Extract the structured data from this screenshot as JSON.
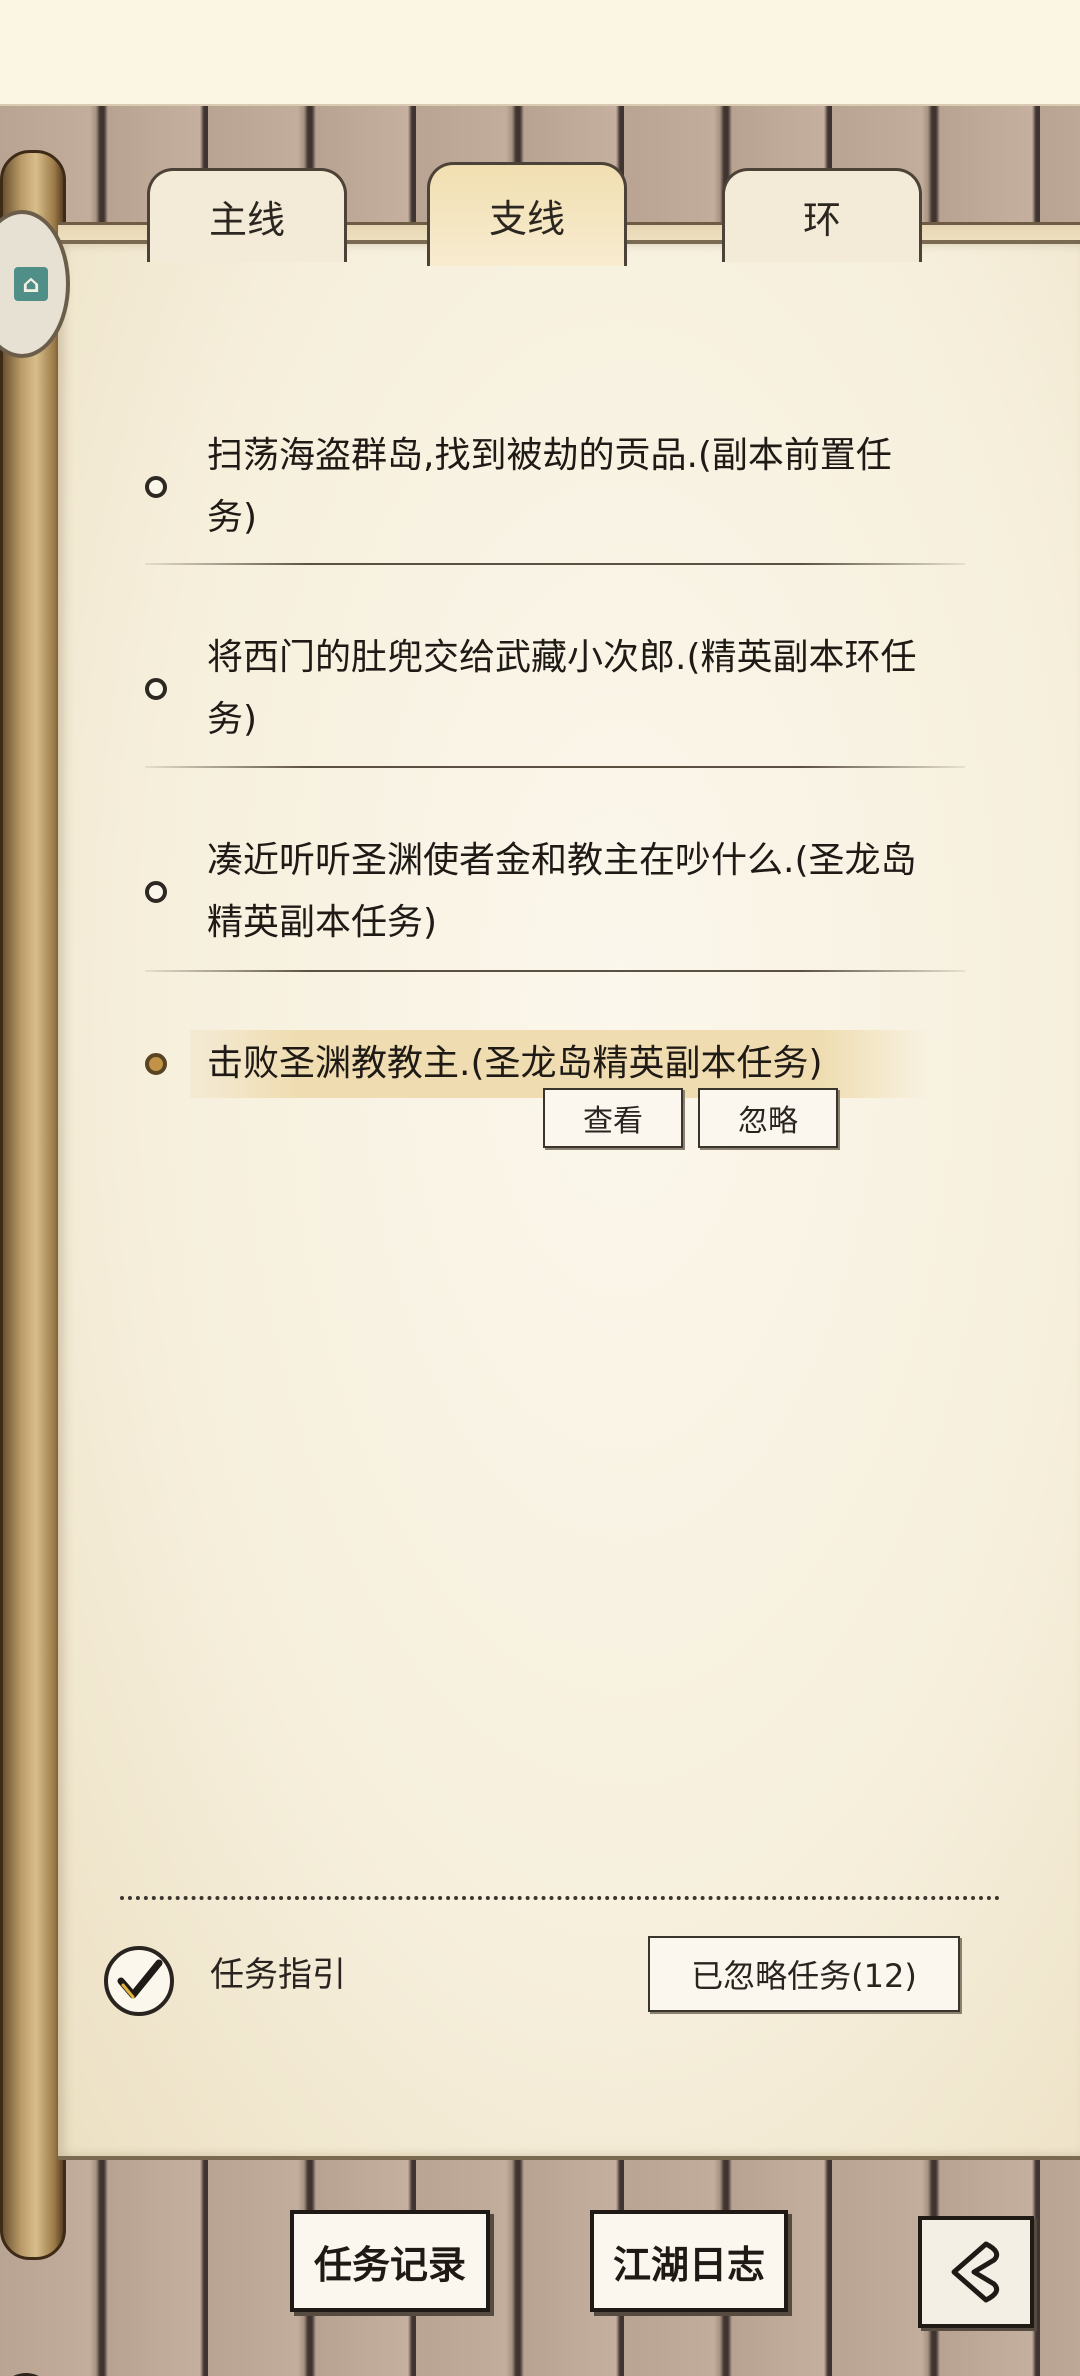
{
  "tabs": [
    {
      "label": "主线",
      "active": false
    },
    {
      "label": "支线",
      "active": true
    },
    {
      "label": "环",
      "active": false
    }
  ],
  "quests": [
    {
      "text": "扫荡海盗群岛,找到被劫的贡品.(副本前置任务)",
      "selected": false
    },
    {
      "text": "将西门的肚兜交给武藏小次郎.(精英副本环任务)",
      "selected": false
    },
    {
      "text": "凑近听听圣渊使者金和教主在吵什么.(圣龙岛精英副本任务)",
      "selected": false
    },
    {
      "text": "击败圣渊教教主.(圣龙岛精英副本任务)",
      "selected": true
    }
  ],
  "quest_actions": {
    "view_label": "查看",
    "ignore_label": "忽略"
  },
  "footer": {
    "guide_label": "任务指引",
    "guide_checked": true,
    "ignored_button_label": "已忽略任务(12)"
  },
  "bottom_nav": {
    "record_label": "任务记录",
    "journal_label": "江湖日志"
  },
  "colors": {
    "parchment": "#f6efdc",
    "selected_dot": "#c09348",
    "highlight": "#efdcb0"
  }
}
